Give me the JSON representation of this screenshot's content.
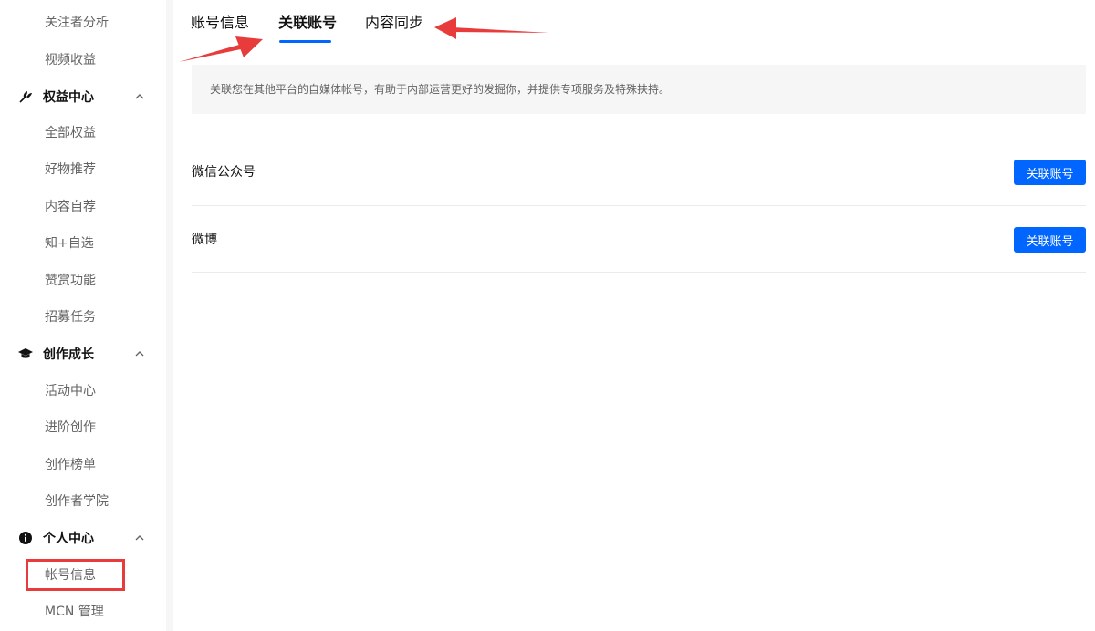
{
  "sidebar": {
    "top_items": [
      "关注者分析",
      "视频收益"
    ],
    "sections": [
      {
        "label": "权益中心",
        "icon": "rights-icon",
        "items": [
          "全部权益",
          "好物推荐",
          "内容自荐",
          "知+自选",
          "赞赏功能",
          "招募任务"
        ]
      },
      {
        "label": "创作成长",
        "icon": "graduation-cap-icon",
        "items": [
          "活动中心",
          "进阶创作",
          "创作榜单",
          "创作者学院"
        ]
      },
      {
        "label": "个人中心",
        "icon": "info-icon",
        "items": [
          "帐号信息",
          "MCN 管理"
        ]
      }
    ],
    "highlighted_item": "帐号信息"
  },
  "tabs": [
    {
      "label": "账号信息",
      "active": false
    },
    {
      "label": "关联账号",
      "active": true
    },
    {
      "label": "内容同步",
      "active": false
    }
  ],
  "notice": "关联您在其他平台的自媒体帐号，有助于内部运营更好的发掘你，并提供专项服务及特殊扶持。",
  "accounts": [
    {
      "platform": "微信公众号",
      "button_label": "关联账号"
    },
    {
      "platform": "微博",
      "button_label": "关联账号"
    }
  ],
  "colors": {
    "accent": "#0066ff",
    "annotation": "#e83b3b",
    "page_bg": "#f6f6f6"
  }
}
